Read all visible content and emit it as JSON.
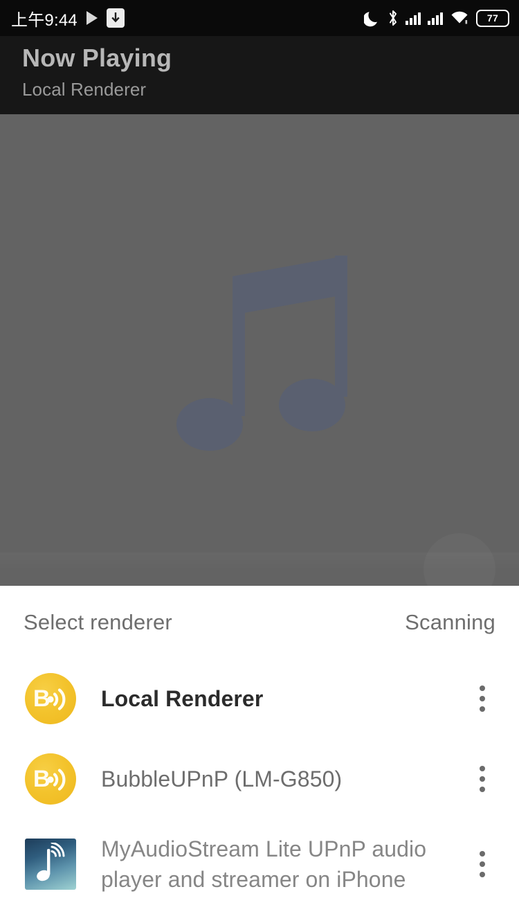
{
  "status_bar": {
    "clock": "上午9:44",
    "battery_level": "77",
    "left_icons": [
      "play-icon",
      "download-icon"
    ],
    "right_icons": [
      "do-not-disturb-moon-icon",
      "bluetooth-icon",
      "signal-sim1-icon",
      "signal-sim2-icon",
      "wifi-icon",
      "battery-icon"
    ]
  },
  "app_bar": {
    "title": "Now Playing",
    "subtitle": "Local Renderer"
  },
  "artwork": {
    "placeholder_icon": "music-note-icon",
    "background_color": "#636363",
    "note_color": "#5a6070"
  },
  "sheet": {
    "title": "Select renderer",
    "status": "Scanning",
    "renderers": [
      {
        "name": "Local Renderer",
        "icon": "bubbleupnp-icon",
        "selected": true,
        "menu": "overflow-menu-icon"
      },
      {
        "name": "BubbleUPnP (LM-G850)",
        "icon": "bubbleupnp-icon",
        "selected": false,
        "menu": "overflow-menu-icon"
      },
      {
        "name": "MyAudioStream Lite UPnP audio player and streamer on iPhone",
        "icon": "myaudiostream-icon",
        "selected": false,
        "menu": "overflow-menu-icon"
      }
    ]
  },
  "colors": {
    "accent_yellow": "#f3c32c",
    "sheet_background": "#ffffff",
    "appbar_background": "#171717",
    "scrim": "#636363"
  }
}
